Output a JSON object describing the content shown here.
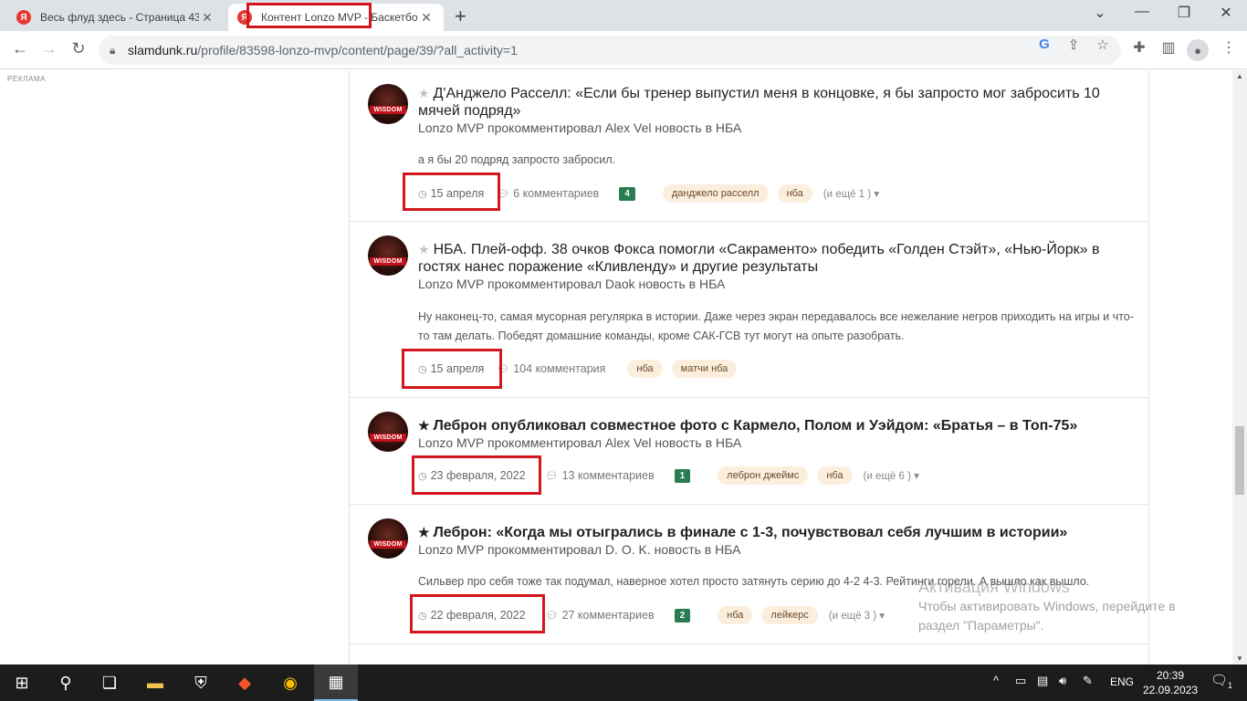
{
  "browser": {
    "tabs": [
      {
        "title": "Весь флуд здесь - Страница 43",
        "close": "✕"
      },
      {
        "title": "Контент Lonzo MVP - Баскетбо",
        "close": "✕"
      }
    ],
    "new_tab": "+",
    "url_domain": "slamdunk.ru",
    "url_path": "/profile/83598-lonzo-mvp/content/page/39/?all_activity=1"
  },
  "page": {
    "ad_label": "РЕКЛАМА",
    "entries": [
      {
        "title": "Д'Анджело Расселл: «Если бы тренер выпустил меня в концовке, я бы запросто мог забросить 10 мячей подряд»",
        "byline": "Lonzo MVP прокомментировал Alex Vel новость в НБА",
        "excerpt": "а я бы 20 подряд запросто забросил.",
        "date": "15 апреля",
        "comments": "6 комментариев",
        "reputation": "4",
        "tags": [
          "данджело расселл",
          "нба"
        ],
        "more": "(и ещё 1 )"
      },
      {
        "title": "НБА. Плей-офф. 38 очков Фокса помогли «Сакраменто» победить «Голден Стэйт», «Нью-Йорк» в гостях нанес поражение «Кливленду» и другие результаты",
        "byline": "Lonzo MVP прокомментировал Daok новость в НБА",
        "excerpt": "Ну наконец-то, самая мусорная регулярка в истории. Даже через экран передавалось все нежелание негров приходить на игры и что-то там делать. Победят домашние команды, кроме САК-ГСВ тут могут на опыте разобрать.",
        "date": "15 апреля",
        "comments": "104 комментария",
        "tags": [
          "нба",
          "матчи нба"
        ]
      },
      {
        "title": "Леброн опубликовал совместное фото с Кармело, Полом и Уэйдом: «Братья – в Топ-75»",
        "byline": "Lonzo MVP прокомментировал Alex Vel новость в НБА",
        "date": "23 февраля, 2022",
        "comments": "13 комментариев",
        "reputation": "1",
        "tags": [
          "леброн джеймс",
          "нба"
        ],
        "more": "(и ещё 6 )"
      },
      {
        "title": "Леброн: «Когда мы отыгрались в финале с 1-3, почувствовал себя лучшим в истории»",
        "byline": "Lonzo MVP прокомментировал D. O. K. новость в НБА",
        "excerpt": "Сильвер про себя тоже так подумал, наверное хотел просто затянуть серию до 4-2 4-3. Рейтинги горели. А вышло как вышло.",
        "date": "22 февраля, 2022",
        "comments": "27 комментариев",
        "reputation": "2",
        "tags": [
          "нба",
          "лейкерс"
        ],
        "more": "(и ещё 3 )"
      }
    ]
  },
  "watermark": {
    "line1": "Активация Windows",
    "line2": "Чтобы активировать Windows, перейдите в",
    "line3": "раздел \"Параметры\"."
  },
  "taskbar": {
    "lang": "ENG",
    "time": "20:39",
    "date": "22.09.2023",
    "notifications": "1"
  }
}
